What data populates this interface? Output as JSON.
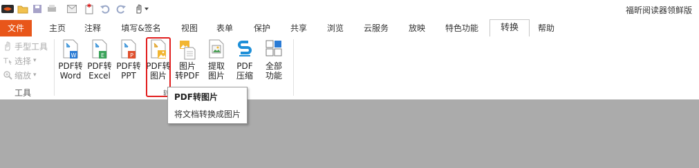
{
  "app": {
    "title": "福昕阅读器领鲜版"
  },
  "quick_access": [
    "app-logo-icon",
    "open-icon",
    "save-icon",
    "print-icon",
    "email-icon",
    "new-icon",
    "undo-icon",
    "redo-icon",
    "hand-icon",
    "customize-icon"
  ],
  "tabs": [
    {
      "label": "文件"
    },
    {
      "label": "主页"
    },
    {
      "label": "注释"
    },
    {
      "label": "填写&签名"
    },
    {
      "label": "视图"
    },
    {
      "label": "表单"
    },
    {
      "label": "保护"
    },
    {
      "label": "共享"
    },
    {
      "label": "浏览"
    },
    {
      "label": "云服务"
    },
    {
      "label": "放映"
    },
    {
      "label": "特色功能"
    },
    {
      "label": "转换"
    },
    {
      "label": "帮助"
    }
  ],
  "active_tab": "转换",
  "tools_group": {
    "items": [
      {
        "label": "手型工具"
      },
      {
        "label": "选择"
      },
      {
        "label": "缩放"
      }
    ],
    "label": "工具"
  },
  "convert_group": {
    "buttons": [
      {
        "label": "PDF转\nWord"
      },
      {
        "label": "PDF转\nExcel"
      },
      {
        "label": "PDF转\nPPT"
      },
      {
        "label": "PDF转\n图片"
      },
      {
        "label": "图片\n转PDF"
      },
      {
        "label": "提取\n图片"
      },
      {
        "label": "PDF\n压缩"
      },
      {
        "label": "全部\n功能"
      }
    ],
    "group_label_partial": "转"
  },
  "tooltip": {
    "title": "PDF转图片",
    "description": "将文档转换成图片"
  },
  "colors": {
    "file_tab": "#e8561a",
    "highlight": "#e11d1d",
    "workspace": "#ababab"
  }
}
